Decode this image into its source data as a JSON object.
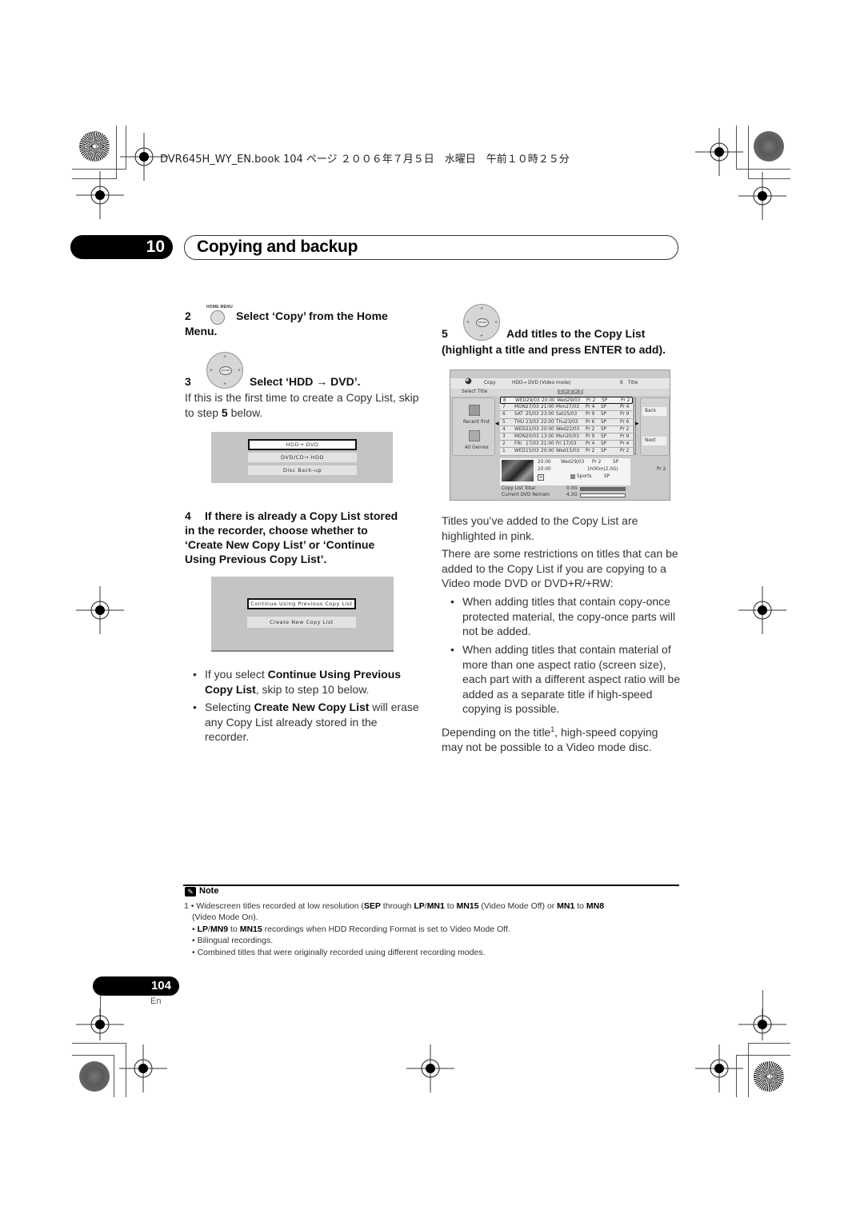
{
  "header": {
    "book_line": "DVR645H_WY_EN.book  104 ページ  ２００６年７月５日　水曜日　午前１０時２５分"
  },
  "chapter": {
    "number": "10",
    "title": "Copying and backup"
  },
  "left_column": {
    "step2": {
      "number": "2",
      "button_label": "HOME MENU",
      "heading": "Select ‘Copy’ from the Home",
      "heading_cont": "Menu."
    },
    "step3": {
      "number": "3",
      "enter_label": "ENTER",
      "heading": "Select ‘HDD → DVD’.",
      "body_pre": "If this is the first time to create a Copy List, skip to step ",
      "body_bold": "5",
      "body_post": " below."
    },
    "menu_screen": {
      "items": [
        "HDD→  DVD",
        "DVD/CD→  HDD",
        "Disc  Back-up"
      ],
      "selected_index": 0
    },
    "step4": {
      "number": "4",
      "heading_lines": [
        "If there is already a Copy List stored",
        "in the recorder, choose whether to",
        "‘Create New Copy List’ or ‘Continue",
        "Using Previous Copy List’."
      ]
    },
    "choice_screen": {
      "items": [
        "Continue Using Previous Copy List",
        "Create New Copy List"
      ],
      "selected_index": 0
    },
    "bullets": [
      {
        "pre": "If you select ",
        "bold": "Continue Using Previous Copy List",
        "post": ", skip to step 10 below."
      },
      {
        "pre": "Selecting ",
        "bold": "Create New Copy List",
        "post": " will erase any Copy List already stored in the recorder."
      }
    ]
  },
  "right_column": {
    "step5": {
      "number": "5",
      "enter_label": "ENTER",
      "heading": "Add titles to the Copy List",
      "heading_cont": "(highlight a title and press ENTER to add)."
    },
    "copy_screen": {
      "top_copy": "Copy",
      "top_mode": "HDD→  DVD  (Video  mode)",
      "top_count": "8",
      "top_count_label": "Title",
      "select_title": "Select  Title",
      "pages": "1 > 2 > 3",
      "left_labels": [
        "Recent  first",
        "All  Genres"
      ],
      "right_buttons": [
        "Back",
        "Next"
      ],
      "rows": [
        {
          "num": "8",
          "day": "WED",
          "date": "29/03",
          "time": "20:00",
          "name": "Wed29/03",
          "ch": "Pr 2",
          "mode": "SP",
          "pr": "Pr 2"
        },
        {
          "num": "7",
          "day": "MON",
          "date": "27/03",
          "time": "21:00",
          "name": "Mon27/03",
          "ch": "Pr 4",
          "mode": "SP",
          "pr": "Pr 4"
        },
        {
          "num": "6",
          "day": "SAT",
          "date": "25/03",
          "time": "23:00",
          "name": "Sat25/03",
          "ch": "Pr 9",
          "mode": "SP",
          "pr": "Pr 9"
        },
        {
          "num": "5",
          "day": "THU",
          "date": "23/03",
          "time": "22:00",
          "name": "Thu23/03",
          "ch": "Pr 6",
          "mode": "SP",
          "pr": "Pr 6"
        },
        {
          "num": "4",
          "day": "WED",
          "date": "22/03",
          "time": "20:00",
          "name": "Wed22/03",
          "ch": "Pr 2",
          "mode": "SP",
          "pr": "Pr 2"
        },
        {
          "num": "3",
          "day": "MON",
          "date": "20/03",
          "time": "13:00",
          "name": "Mon20/03",
          "ch": "Pr 9",
          "mode": "SP",
          "pr": "Pr 9"
        },
        {
          "num": "2",
          "day": "FRI",
          "date": "17/03",
          "time": "21:00",
          "name": "Fri 17/03",
          "ch": "Pr 4",
          "mode": "SP",
          "pr": "Pr 4"
        },
        {
          "num": "1",
          "day": "WED",
          "date": "15/03",
          "time": "20:00",
          "name": "Wed15/03",
          "ch": "Pr 2",
          "mode": "SP",
          "pr": "Pr 2"
        }
      ],
      "selected_row": 0,
      "info": {
        "start": "20:00",
        "end": "20:00",
        "name": "Wed29/03",
        "channel": "Pr 2",
        "mode": "SP",
        "duration": "1h00m(2.0G)",
        "genre": "Sports",
        "genre_mode": "SP",
        "right_channel": "Pr 2"
      },
      "copy_list_total_label": "Copy  List  Total",
      "copy_list_total_value": "0.0G",
      "dvd_remain_label": "Current  DVD  Remain",
      "dvd_remain_value": "4.3G"
    },
    "para1": "Titles you’ve added to the Copy List are highlighted in pink.",
    "para2": "There are some restrictions on titles that can be added to the Copy List if you are copying to a Video mode DVD or DVD+R/+RW:",
    "bullets": [
      "When adding titles that contain copy-once protected material, the copy-once parts will not be added.",
      "When adding titles that contain material of more than one aspect ratio (screen size), each part with a different aspect ratio will be added as a separate title if high-speed copying is possible."
    ],
    "para3_pre": "Depending on the title",
    "para3_sup": "1",
    "para3_post": ", high-speed copying may not be possible to a Video mode disc."
  },
  "note": {
    "title": "Note",
    "line1_num": "1",
    "line1": {
      "a": "• Widescreen titles recorded at low resolution (",
      "b": "SEP",
      "c": " through ",
      "d": "LP",
      "e": "/",
      "f": "MN1",
      "g": " to ",
      "h": "MN15",
      "i": " (Video Mode Off) or ",
      "j": "MN1",
      "k": " to ",
      "l": "MN8"
    },
    "line1_cont": "(Video Mode On).",
    "line2": {
      "a": "LP",
      "b": "/",
      "c": "MN9",
      "d": " to ",
      "e": "MN15",
      "f": " recordings when HDD Recording Format is set to Video Mode Off."
    },
    "line3": "• Bilingual recordings.",
    "line4": "• Combined titles that were originally recorded using different recording modes."
  },
  "footer": {
    "page_number": "104",
    "language": "En"
  }
}
